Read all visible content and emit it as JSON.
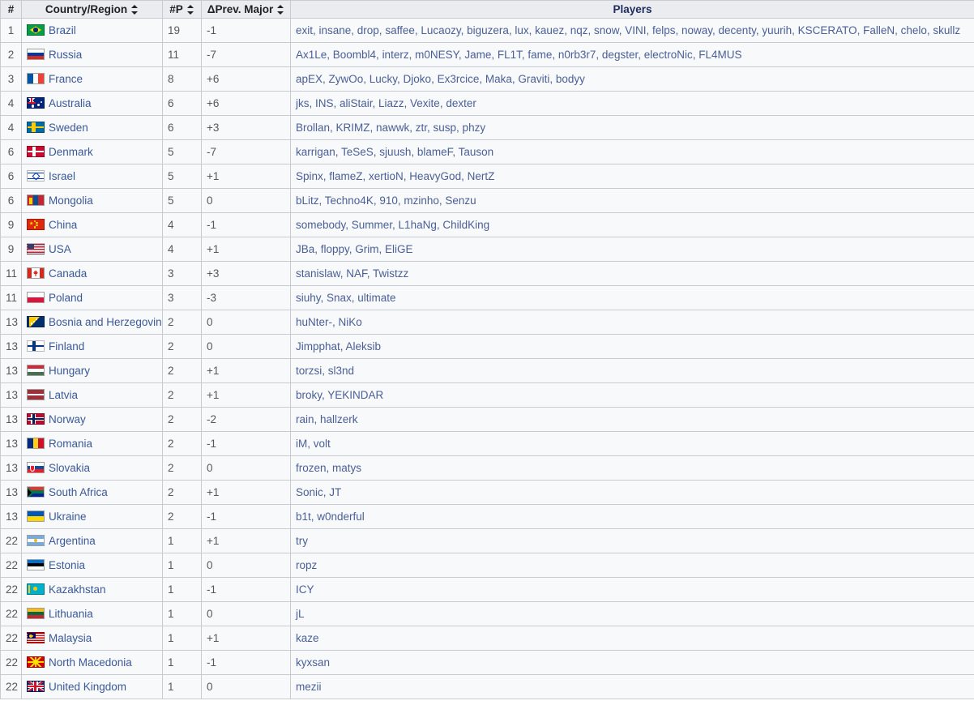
{
  "table": {
    "columns": [
      {
        "key": "rank",
        "label": "#",
        "sortable": false
      },
      {
        "key": "country",
        "label": "Country/Region",
        "sortable": true
      },
      {
        "key": "players_count",
        "label": "#P",
        "sortable": true
      },
      {
        "key": "delta",
        "label": "ΔPrev. Major",
        "sortable": true
      },
      {
        "key": "players",
        "label": "Players",
        "sortable": false
      }
    ],
    "rows": [
      {
        "rank": "1",
        "flag": "brazil",
        "country": "Brazil",
        "players_count": "19",
        "delta": "-1",
        "players": "exit, insane, drop, saffee, Lucaozy, biguzera, lux, kauez, nqz, snow, VINI, felps, noway, decenty, yuurih, KSCERATO, FalleN, chelo, skullz"
      },
      {
        "rank": "2",
        "flag": "russia",
        "country": "Russia",
        "players_count": "11",
        "delta": "-7",
        "players": "Ax1Le, Boombl4, interz, m0NESY, Jame, FL1T, fame, n0rb3r7, degster, electroNic, FL4MUS"
      },
      {
        "rank": "3",
        "flag": "france",
        "country": "France",
        "players_count": "8",
        "delta": "+6",
        "players": "apEX, ZywOo, Lucky, Djoko, Ex3rcice, Maka, Graviti, bodyy"
      },
      {
        "rank": "4",
        "flag": "australia",
        "country": "Australia",
        "players_count": "6",
        "delta": "+6",
        "players": "jks, INS, aliStair, Liazz, Vexite, dexter"
      },
      {
        "rank": "4",
        "flag": "sweden",
        "country": "Sweden",
        "players_count": "6",
        "delta": "+3",
        "players": "Brollan, KRIMZ, nawwk, ztr, susp, phzy"
      },
      {
        "rank": "6",
        "flag": "denmark",
        "country": "Denmark",
        "players_count": "5",
        "delta": "-7",
        "players": "karrigan, TeSeS, sjuush, blameF, Tauson"
      },
      {
        "rank": "6",
        "flag": "israel",
        "country": "Israel",
        "players_count": "5",
        "delta": "+1",
        "players": "Spinx, flameZ, xertioN, HeavyGod, NertZ"
      },
      {
        "rank": "6",
        "flag": "mongolia",
        "country": "Mongolia",
        "players_count": "5",
        "delta": "0",
        "players": "bLitz, Techno4K, 910, mzinho, Senzu"
      },
      {
        "rank": "9",
        "flag": "china",
        "country": "China",
        "players_count": "4",
        "delta": "-1",
        "players": "somebody, Summer, L1haNg, ChildKing"
      },
      {
        "rank": "9",
        "flag": "usa",
        "country": "USA",
        "players_count": "4",
        "delta": "+1",
        "players": "JBa, floppy, Grim, EliGE"
      },
      {
        "rank": "11",
        "flag": "canada",
        "country": "Canada",
        "players_count": "3",
        "delta": "+3",
        "players": "stanislaw, NAF, Twistzz"
      },
      {
        "rank": "11",
        "flag": "poland",
        "country": "Poland",
        "players_count": "3",
        "delta": "-3",
        "players": "siuhy, Snax, ultimate"
      },
      {
        "rank": "13",
        "flag": "bosnia",
        "country": "Bosnia and Herzegovina",
        "players_count": "2",
        "delta": "0",
        "players": "huNter-, NiKo"
      },
      {
        "rank": "13",
        "flag": "finland",
        "country": "Finland",
        "players_count": "2",
        "delta": "0",
        "players": "Jimpphat, Aleksib"
      },
      {
        "rank": "13",
        "flag": "hungary",
        "country": "Hungary",
        "players_count": "2",
        "delta": "+1",
        "players": "torzsi, sl3nd"
      },
      {
        "rank": "13",
        "flag": "latvia",
        "country": "Latvia",
        "players_count": "2",
        "delta": "+1",
        "players": "broky, YEKINDAR"
      },
      {
        "rank": "13",
        "flag": "norway",
        "country": "Norway",
        "players_count": "2",
        "delta": "-2",
        "players": "rain, hallzerk"
      },
      {
        "rank": "13",
        "flag": "romania",
        "country": "Romania",
        "players_count": "2",
        "delta": "-1",
        "players": "iM, volt"
      },
      {
        "rank": "13",
        "flag": "slovakia",
        "country": "Slovakia",
        "players_count": "2",
        "delta": "0",
        "players": "frozen, matys"
      },
      {
        "rank": "13",
        "flag": "southafrica",
        "country": "South Africa",
        "players_count": "2",
        "delta": "+1",
        "players": "Sonic, JT"
      },
      {
        "rank": "13",
        "flag": "ukraine",
        "country": "Ukraine",
        "players_count": "2",
        "delta": "-1",
        "players": "b1t, w0nderful"
      },
      {
        "rank": "22",
        "flag": "argentina",
        "country": "Argentina",
        "players_count": "1",
        "delta": "+1",
        "players": "try"
      },
      {
        "rank": "22",
        "flag": "estonia",
        "country": "Estonia",
        "players_count": "1",
        "delta": "0",
        "players": "ropz"
      },
      {
        "rank": "22",
        "flag": "kazakhstan",
        "country": "Kazakhstan",
        "players_count": "1",
        "delta": "-1",
        "players": "ICY"
      },
      {
        "rank": "22",
        "flag": "lithuania",
        "country": "Lithuania",
        "players_count": "1",
        "delta": "0",
        "players": "jL"
      },
      {
        "rank": "22",
        "flag": "malaysia",
        "country": "Malaysia",
        "players_count": "1",
        "delta": "+1",
        "players": "kaze"
      },
      {
        "rank": "22",
        "flag": "macedonia",
        "country": "North Macedonia",
        "players_count": "1",
        "delta": "-1",
        "players": "kyxsan"
      },
      {
        "rank": "22",
        "flag": "uk",
        "country": "United Kingdom",
        "players_count": "1",
        "delta": "0",
        "players": "mezii"
      }
    ]
  },
  "colors": {
    "header_bg": "#eaecf0",
    "row_bg": "#f8f9fa",
    "border": "#c8ccd1",
    "link": "#3b5998",
    "players_text": "#4a5f96",
    "header_players_text": "#202c5e",
    "muted_text": "#54595d"
  },
  "icons": {
    "sort": "sort-both-icon"
  }
}
